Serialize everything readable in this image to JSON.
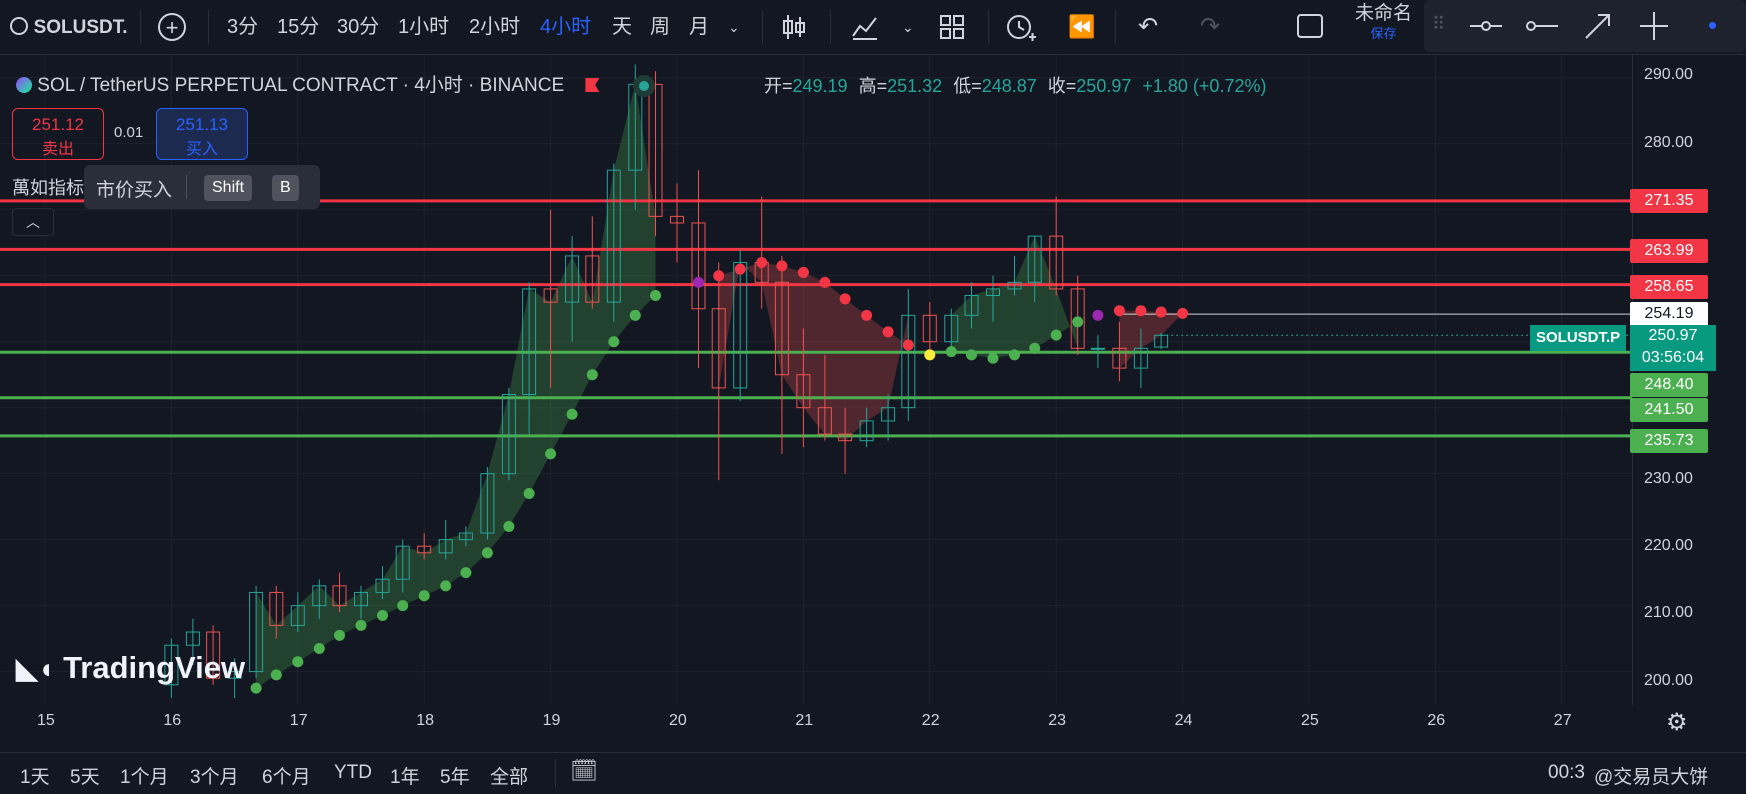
{
  "toolbar": {
    "symbol": "SOLUSDT.",
    "intervals": [
      "3分",
      "15分",
      "30分",
      "1小时",
      "2小时",
      "4小时",
      "天",
      "周",
      "月"
    ],
    "active_interval": "4小时",
    "layout_name": "未命名",
    "save_label": "保存"
  },
  "legend": {
    "title": "SOL / TetherUS PERPETUAL CONTRACT · 4小时 · BINANCE",
    "open_label": "开=",
    "open": "249.19",
    "high_label": "高=",
    "high": "251.32",
    "low_label": "低=",
    "low": "248.87",
    "close_label": "收=",
    "close": "250.97",
    "change": "+1.80 (+0.72%)"
  },
  "trade": {
    "sell_price": "251.12",
    "sell_label": "卖出",
    "spread": "0.01",
    "buy_price": "251.13",
    "buy_label": "买入",
    "indicator_partial": "萬如指标",
    "tooltip_text": "市价买入",
    "tooltip_key1": "Shift",
    "tooltip_key2": "B"
  },
  "watermark": "TradingView",
  "price_axis": {
    "ticks": [
      "290.00",
      "280.00",
      "230.00",
      "220.00",
      "210.00",
      "200.00"
    ],
    "level_labels": [
      {
        "value": "271.35",
        "color": "#f23645"
      },
      {
        "value": "263.99",
        "color": "#f23645"
      },
      {
        "value": "258.65",
        "color": "#f23645"
      },
      {
        "value": "248.40",
        "color": "#4caf50"
      },
      {
        "value": "241.50",
        "color": "#4caf50"
      },
      {
        "value": "235.73",
        "color": "#4caf50"
      }
    ],
    "crosshair_price": "254.19",
    "current_symbol": "SOLUSDT.P",
    "current_price": "250.97",
    "countdown": "03:56:04"
  },
  "time_axis": {
    "ticks": [
      "15",
      "16",
      "17",
      "18",
      "19",
      "20",
      "21",
      "22",
      "23",
      "24",
      "25",
      "26",
      "27"
    ]
  },
  "ranges": [
    "1天",
    "5天",
    "1个月",
    "3个月",
    "6个月",
    "YTD",
    "1年",
    "5年",
    "全部"
  ],
  "footer": {
    "time_partial": "00:3",
    "watermark_text": "@交易员大饼"
  },
  "colors": {
    "up": "#26a69a",
    "down": "#ef5350",
    "support": "#4caf50",
    "resistance": "#f23645",
    "accent": "#2962ff"
  },
  "chart_data": {
    "type": "candlestick",
    "interval": "4小时",
    "ylim": [
      196,
      293
    ],
    "x_ticks": [
      "15",
      "16",
      "17",
      "18",
      "19",
      "20",
      "21",
      "22",
      "23",
      "24",
      "25",
      "26",
      "27"
    ],
    "x_range": [
      15.0,
      27.6
    ],
    "horizontal_levels": [
      271.35,
      263.99,
      258.65,
      248.4,
      241.5,
      235.73
    ],
    "candles": [
      {
        "t": 16.0,
        "o": 198,
        "h": 205,
        "l": 196,
        "c": 204
      },
      {
        "t": 16.17,
        "o": 204,
        "h": 208,
        "l": 201,
        "c": 206
      },
      {
        "t": 16.33,
        "o": 206,
        "h": 207,
        "l": 198,
        "c": 199
      },
      {
        "t": 16.5,
        "o": 199,
        "h": 202,
        "l": 196,
        "c": 200
      },
      {
        "t": 16.67,
        "o": 200,
        "h": 213,
        "l": 199,
        "c": 212
      },
      {
        "t": 16.83,
        "o": 212,
        "h": 213,
        "l": 205,
        "c": 207
      },
      {
        "t": 17.0,
        "o": 207,
        "h": 212,
        "l": 206,
        "c": 210
      },
      {
        "t": 17.17,
        "o": 210,
        "h": 214,
        "l": 208,
        "c": 213
      },
      {
        "t": 17.33,
        "o": 213,
        "h": 215,
        "l": 209,
        "c": 210
      },
      {
        "t": 17.5,
        "o": 210,
        "h": 213,
        "l": 208,
        "c": 212
      },
      {
        "t": 17.67,
        "o": 212,
        "h": 216,
        "l": 211,
        "c": 214
      },
      {
        "t": 17.83,
        "o": 214,
        "h": 220,
        "l": 212,
        "c": 219
      },
      {
        "t": 18.0,
        "o": 219,
        "h": 221,
        "l": 217,
        "c": 218
      },
      {
        "t": 18.17,
        "o": 218,
        "h": 223,
        "l": 217,
        "c": 220
      },
      {
        "t": 18.33,
        "o": 220,
        "h": 222,
        "l": 219,
        "c": 221
      },
      {
        "t": 18.5,
        "o": 221,
        "h": 231,
        "l": 220,
        "c": 230
      },
      {
        "t": 18.67,
        "o": 230,
        "h": 243,
        "l": 229,
        "c": 242
      },
      {
        "t": 18.83,
        "o": 242,
        "h": 259,
        "l": 236,
        "c": 258
      },
      {
        "t": 19.0,
        "o": 258,
        "h": 270,
        "l": 243,
        "c": 256
      },
      {
        "t": 19.17,
        "o": 256,
        "h": 266,
        "l": 250,
        "c": 263
      },
      {
        "t": 19.33,
        "o": 263,
        "h": 269,
        "l": 255,
        "c": 256
      },
      {
        "t": 19.5,
        "o": 256,
        "h": 277,
        "l": 253,
        "c": 276
      },
      {
        "t": 19.67,
        "o": 276,
        "h": 292,
        "l": 270,
        "c": 289
      },
      {
        "t": 19.83,
        "o": 289,
        "h": 291,
        "l": 266,
        "c": 269
      },
      {
        "t": 20.0,
        "o": 269,
        "h": 274,
        "l": 262,
        "c": 268
      },
      {
        "t": 20.17,
        "o": 268,
        "h": 276,
        "l": 246,
        "c": 255
      },
      {
        "t": 20.33,
        "o": 255,
        "h": 262,
        "l": 229,
        "c": 243
      },
      {
        "t": 20.5,
        "o": 243,
        "h": 264,
        "l": 241,
        "c": 262
      },
      {
        "t": 20.67,
        "o": 262,
        "h": 272,
        "l": 255,
        "c": 259
      },
      {
        "t": 20.83,
        "o": 259,
        "h": 263,
        "l": 233,
        "c": 245
      },
      {
        "t": 21.0,
        "o": 245,
        "h": 252,
        "l": 234,
        "c": 240
      },
      {
        "t": 21.17,
        "o": 240,
        "h": 248,
        "l": 235,
        "c": 236
      },
      {
        "t": 21.33,
        "o": 236,
        "h": 240,
        "l": 230,
        "c": 235
      },
      {
        "t": 21.5,
        "o": 235,
        "h": 240,
        "l": 234,
        "c": 238
      },
      {
        "t": 21.67,
        "o": 238,
        "h": 242,
        "l": 235,
        "c": 240
      },
      {
        "t": 21.83,
        "o": 240,
        "h": 258,
        "l": 238,
        "c": 254
      },
      {
        "t": 22.0,
        "o": 254,
        "h": 256,
        "l": 248,
        "c": 250
      },
      {
        "t": 22.17,
        "o": 250,
        "h": 255,
        "l": 248,
        "c": 254
      },
      {
        "t": 22.33,
        "o": 254,
        "h": 259,
        "l": 252,
        "c": 257
      },
      {
        "t": 22.5,
        "o": 257,
        "h": 260,
        "l": 253,
        "c": 258
      },
      {
        "t": 22.67,
        "o": 258,
        "h": 263,
        "l": 257,
        "c": 259
      },
      {
        "t": 22.83,
        "o": 259,
        "h": 266,
        "l": 256,
        "c": 266
      },
      {
        "t": 23.0,
        "o": 266,
        "h": 272,
        "l": 257,
        "c": 258
      },
      {
        "t": 23.17,
        "o": 258,
        "h": 260,
        "l": 248,
        "c": 249
      },
      {
        "t": 23.33,
        "o": 249,
        "h": 251,
        "l": 246,
        "c": 249
      },
      {
        "t": 23.5,
        "o": 249,
        "h": 253,
        "l": 244,
        "c": 246
      },
      {
        "t": 23.67,
        "o": 246,
        "h": 252,
        "l": 243,
        "c": 249
      },
      {
        "t": 23.83,
        "o": 249.19,
        "h": 251.32,
        "l": 248.87,
        "c": 250.97
      }
    ],
    "sar_dots": [
      {
        "t": 16.67,
        "v": 197.5,
        "c": "green"
      },
      {
        "t": 16.83,
        "v": 199.5,
        "c": "green"
      },
      {
        "t": 17.0,
        "v": 201.5,
        "c": "green"
      },
      {
        "t": 17.17,
        "v": 203.5,
        "c": "green"
      },
      {
        "t": 17.33,
        "v": 205.5,
        "c": "green"
      },
      {
        "t": 17.5,
        "v": 207,
        "c": "green"
      },
      {
        "t": 17.67,
        "v": 208.5,
        "c": "green"
      },
      {
        "t": 17.83,
        "v": 210,
        "c": "green"
      },
      {
        "t": 18.0,
        "v": 211.5,
        "c": "green"
      },
      {
        "t": 18.17,
        "v": 213,
        "c": "green"
      },
      {
        "t": 18.33,
        "v": 215,
        "c": "green"
      },
      {
        "t": 18.5,
        "v": 218,
        "c": "green"
      },
      {
        "t": 18.67,
        "v": 222,
        "c": "green"
      },
      {
        "t": 18.83,
        "v": 227,
        "c": "green"
      },
      {
        "t": 19.0,
        "v": 233,
        "c": "green"
      },
      {
        "t": 19.17,
        "v": 239,
        "c": "green"
      },
      {
        "t": 19.33,
        "v": 245,
        "c": "green"
      },
      {
        "t": 19.5,
        "v": 250,
        "c": "green"
      },
      {
        "t": 19.67,
        "v": 254,
        "c": "green"
      },
      {
        "t": 19.83,
        "v": 257,
        "c": "green"
      },
      {
        "t": 20.17,
        "v": 259,
        "c": "purple"
      },
      {
        "t": 20.33,
        "v": 260,
        "c": "red"
      },
      {
        "t": 20.5,
        "v": 261,
        "c": "red"
      },
      {
        "t": 20.67,
        "v": 262,
        "c": "red"
      },
      {
        "t": 20.83,
        "v": 261.5,
        "c": "red"
      },
      {
        "t": 21.0,
        "v": 260.5,
        "c": "red"
      },
      {
        "t": 21.17,
        "v": 259,
        "c": "red"
      },
      {
        "t": 21.33,
        "v": 256.5,
        "c": "red"
      },
      {
        "t": 21.5,
        "v": 254,
        "c": "red"
      },
      {
        "t": 21.67,
        "v": 251.5,
        "c": "red"
      },
      {
        "t": 21.83,
        "v": 249.5,
        "c": "red"
      },
      {
        "t": 22.0,
        "v": 248,
        "c": "yellow"
      },
      {
        "t": 22.17,
        "v": 248.5,
        "c": "green"
      },
      {
        "t": 22.33,
        "v": 248,
        "c": "green"
      },
      {
        "t": 22.5,
        "v": 247.5,
        "c": "green"
      },
      {
        "t": 22.67,
        "v": 248,
        "c": "green"
      },
      {
        "t": 22.83,
        "v": 249,
        "c": "green"
      },
      {
        "t": 23.0,
        "v": 251,
        "c": "green"
      },
      {
        "t": 23.17,
        "v": 253,
        "c": "green"
      },
      {
        "t": 23.33,
        "v": 254,
        "c": "purple"
      },
      {
        "t": 23.5,
        "v": 254.7,
        "c": "red"
      },
      {
        "t": 23.67,
        "v": 254.7,
        "c": "red"
      },
      {
        "t": 23.83,
        "v": 254.5,
        "c": "red"
      },
      {
        "t": 24.0,
        "v": 254.3,
        "c": "red"
      }
    ]
  }
}
